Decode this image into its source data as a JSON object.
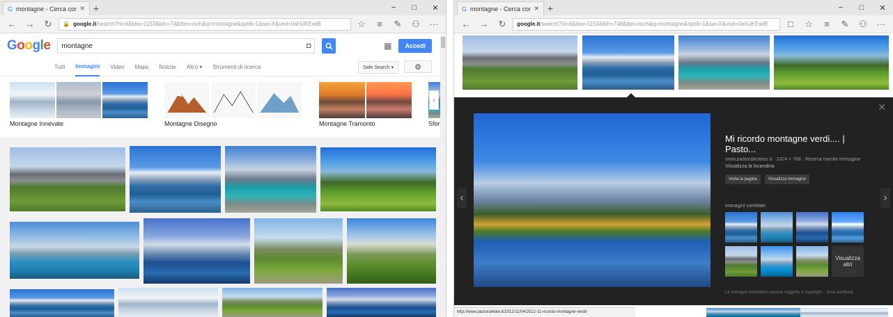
{
  "left": {
    "tab_title": "montagne - Cerca con G",
    "address_domain": "google.it",
    "address_rest": "/search?hl=it&biw=1153&bih=74&tbm=isch&q=montagne&spell=1&sa=X&ved=0ahUKEwiB",
    "logo": "Google",
    "query": "montagne",
    "accedi": "Accedi",
    "tabs": [
      "Tutti",
      "Immagini",
      "Video",
      "Maps",
      "Notizie",
      "Altro ▾",
      "Strumenti di ricerca"
    ],
    "safe_search": "Safe Search ▾",
    "related": [
      {
        "label": "Montagne Innevate"
      },
      {
        "label": "Montagne Disegno"
      },
      {
        "label": "Montagne Tramonto"
      },
      {
        "label": "Sfondi Deskto"
      }
    ]
  },
  "right": {
    "tab_title": "montagne - Cerca con G",
    "address_domain": "google.it",
    "address_rest": "/search?hl=it&biw=1153&bih=748&tbm=isch&q=montagne&spell=1&sa=X&ved=0ahUKEwiB",
    "title": "Mi ricordo montagne verdi.... | Pasto...",
    "meta": "www.pastoralestesc.it · 1024 × 768 · Ricerca tramite immagine",
    "visualizza_locandina": "Visualizza la locandina",
    "btn_visit": "Visita la pagina",
    "btn_view": "Visualizza immagine",
    "related_header": "Immagini correlate:",
    "visualizza_altro": "Visualizza altri",
    "disclaimer": "Le immagini potrebbero essere soggette a copyright.  ·  Invia feedback",
    "status_url": "http://www.pastoraledei.it/2012/11/04/2012-11-ricordo-montagne-verdi/"
  },
  "icons": {
    "back": "←",
    "forward": "→",
    "refresh": "↻",
    "lock": "🔒",
    "star": "☆",
    "menu": "≡",
    "note": "✎",
    "share": "⚇",
    "more": "···",
    "camera": "◘",
    "search": "🔍",
    "apps": "▦",
    "gear": "⚙",
    "min": "−",
    "max": "□",
    "close": "✕",
    "tabclose": "✕",
    "newtab": "+",
    "prev": "‹",
    "next": "›"
  }
}
